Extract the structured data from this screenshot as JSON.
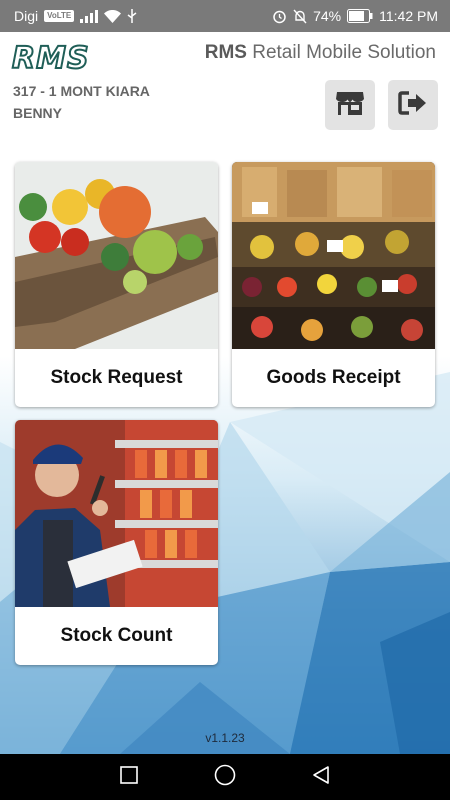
{
  "status_bar": {
    "carrier": "Digi",
    "volte": "VoLTE",
    "battery": "74%",
    "time": "11:42 PM"
  },
  "header": {
    "logo": "RMS",
    "title_bold": "RMS",
    "title_rest": "Retail Mobile Solution",
    "store": "317 - 1 MONT KIARA",
    "user": "BENNY",
    "store_icon": "storefront-icon",
    "logout_icon": "logout-icon"
  },
  "tiles": [
    {
      "label": "Stock Request",
      "image": "vegetable-crate"
    },
    {
      "label": "Goods Receipt",
      "image": "produce-shelves"
    },
    {
      "label": "Stock Count",
      "image": "worker-with-clipboard"
    }
  ],
  "version": "v1.1.23",
  "nav": {
    "recents": "recents-icon",
    "home": "home-icon",
    "back": "back-icon"
  },
  "colors": {
    "logo": "#1f5e57",
    "status_bar": "#7a7a7a",
    "nav_bar": "#000000",
    "header_button": "#e3e3e3"
  }
}
